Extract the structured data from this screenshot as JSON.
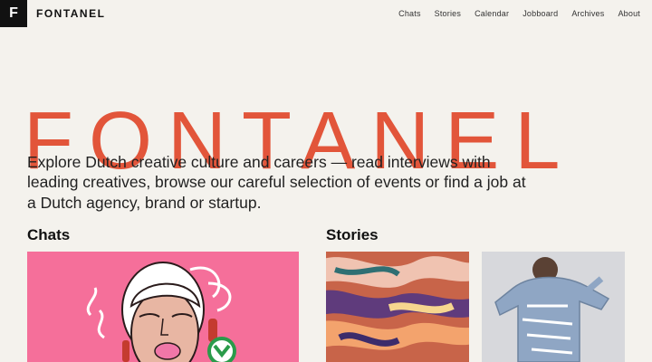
{
  "header": {
    "logo_letter": "F",
    "brand": "FONTANEL",
    "nav": [
      "Chats",
      "Stories",
      "Calendar",
      "Jobboard",
      "Archives",
      "About"
    ]
  },
  "hero": {
    "title": "FONTANEL",
    "intro": "Explore Dutch creative culture and careers — read interviews with leading creatives, browse our careful selection of events or find a job at a Dutch agency, brand or startup."
  },
  "sections": {
    "chats_title": "Chats",
    "stories_title": "Stories"
  },
  "colors": {
    "background": "#f4f2ed",
    "accent": "#e2553a",
    "chat_card": "#f56f9a"
  }
}
